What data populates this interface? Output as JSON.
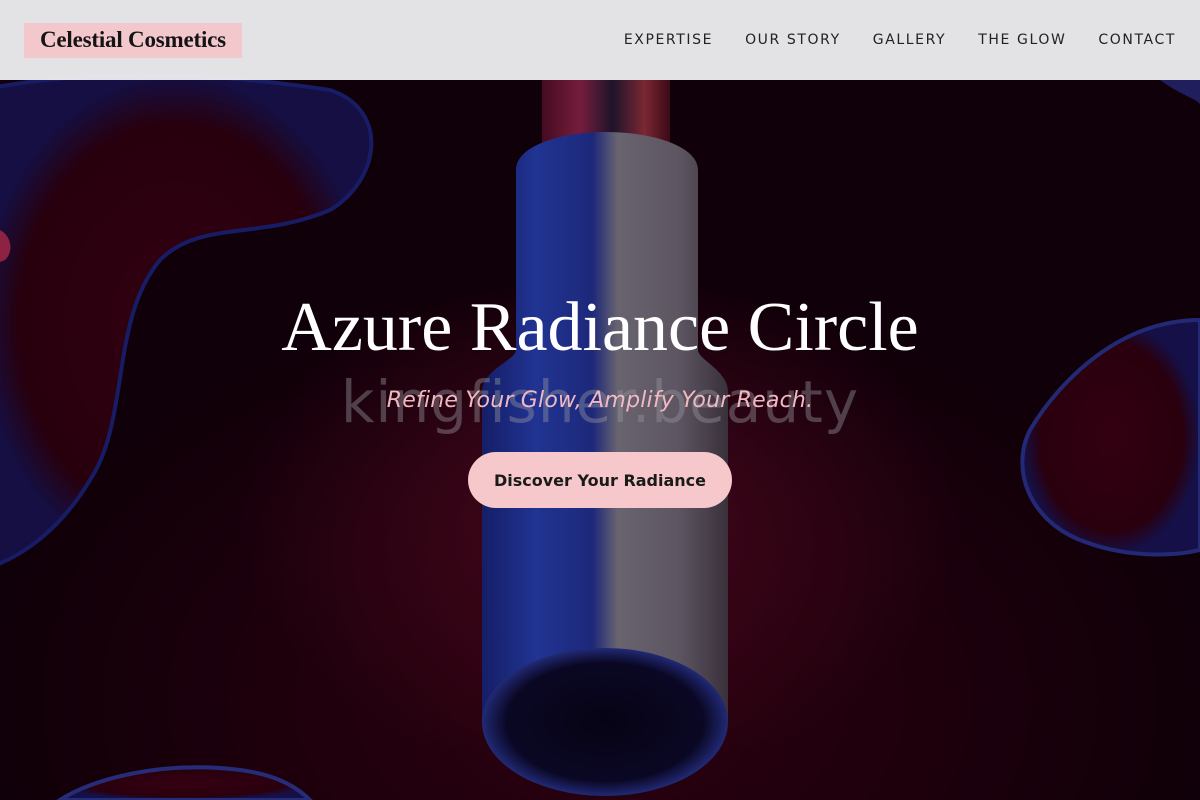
{
  "header": {
    "logo_text": "Celestial Cosmetics",
    "nav": [
      {
        "label": "EXPERTISE"
      },
      {
        "label": "OUR STORY"
      },
      {
        "label": "GALLERY"
      },
      {
        "label": "THE GLOW"
      },
      {
        "label": "CONTACT"
      }
    ]
  },
  "hero": {
    "title": "Azure Radiance Circle",
    "watermark": "kingfisher.beauty",
    "tagline": "Refine Your Glow, Amplify Your Reach.",
    "cta_label": "Discover Your Radiance",
    "background_image": "lipstick-tube-image"
  },
  "colors": {
    "header_bg": "#ececee",
    "logo_bg": "#f3c8cc",
    "tagline": "#f2b9c2",
    "cta_bg": "#f6c7cb",
    "hero_bg": "#12000a"
  }
}
